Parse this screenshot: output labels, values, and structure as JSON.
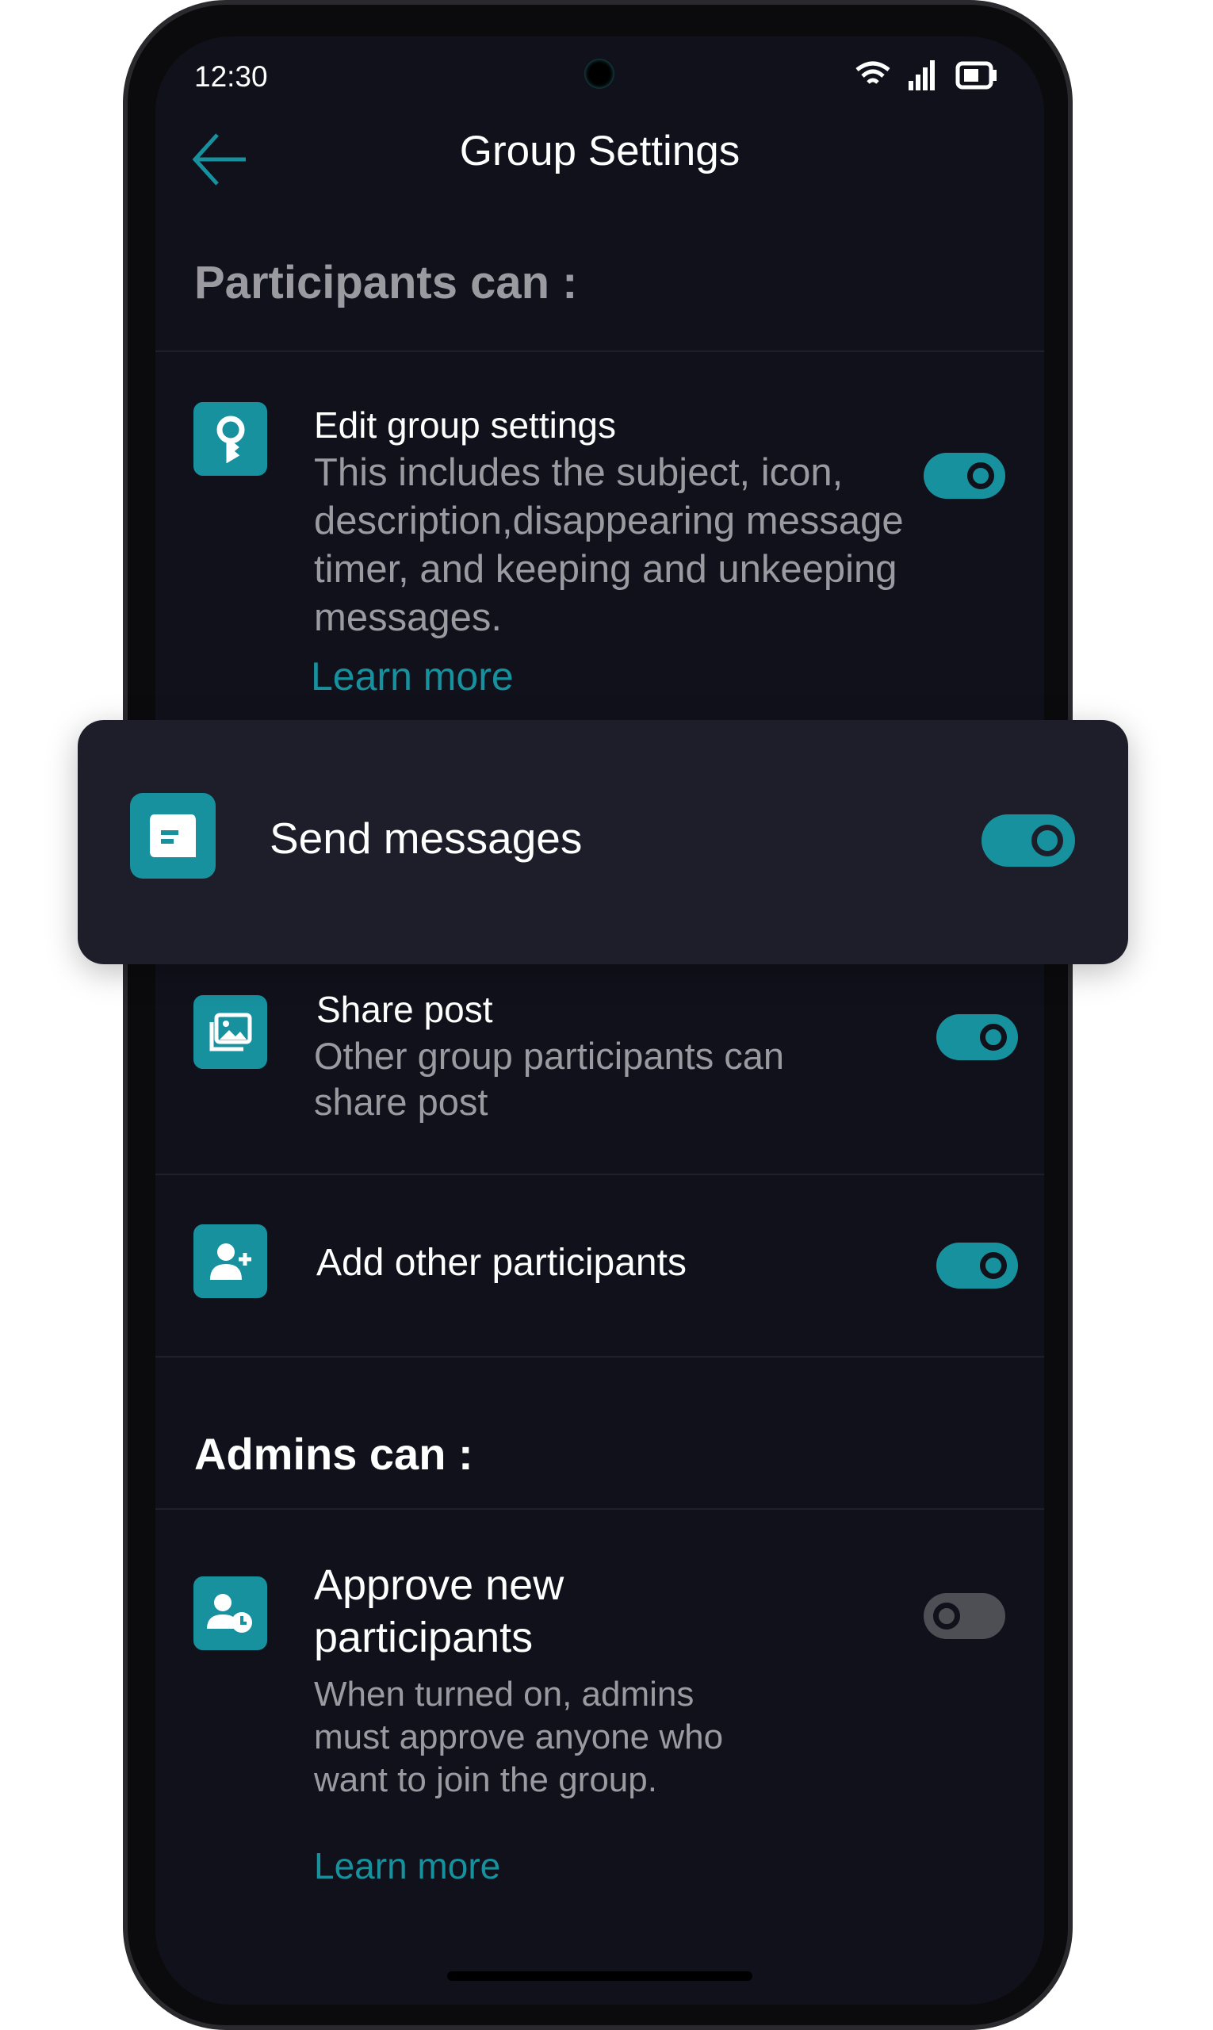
{
  "status_bar": {
    "time": "12:30",
    "icons": [
      "wifi-icon",
      "signal-icon",
      "battery-icon"
    ]
  },
  "header": {
    "title": "Group Settings",
    "back_icon": "arrow-left-icon"
  },
  "accent": "#17919e",
  "participants_section": {
    "heading": "Participants can :",
    "items": [
      {
        "title": "Edit group settings",
        "description": "This includes the subject, icon, description,disappearing message timer, and keeping and unkeeping messages.",
        "link": "Learn more",
        "enabled": true,
        "icon": "key-icon"
      },
      {
        "title": "Send messages",
        "enabled": true,
        "icon": "message-icon"
      },
      {
        "title": "Share post",
        "description": "Other group participants can share post",
        "enabled": true,
        "icon": "image-icon"
      },
      {
        "title": "Add other participants",
        "enabled": true,
        "icon": "add-user-icon"
      }
    ]
  },
  "admins_section": {
    "heading": "Admins can :",
    "items": [
      {
        "title": "Approve new participants",
        "description": "When turned on, admins must approve anyone who want to join the group.",
        "link": "Learn more",
        "enabled": false,
        "icon": "user-clock-icon"
      }
    ]
  }
}
